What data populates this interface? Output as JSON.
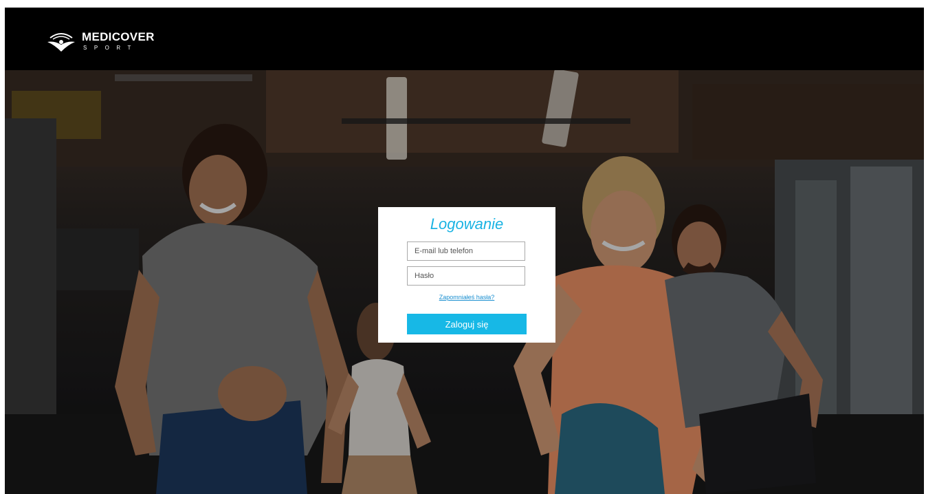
{
  "brand": {
    "name": "MEDICOVER",
    "subtitle": "SPORT",
    "logo_icon": "medicover-logo-icon"
  },
  "login": {
    "title": "Logowanie",
    "email_placeholder": "E-mail lub telefon",
    "password_placeholder": "Hasło",
    "forgot_link": "Zapomniałeś hasła?",
    "submit_label": "Zaloguj się"
  },
  "colors": {
    "accent": "#17b8e6",
    "header_bg": "#000000",
    "card_bg": "#ffffff"
  }
}
